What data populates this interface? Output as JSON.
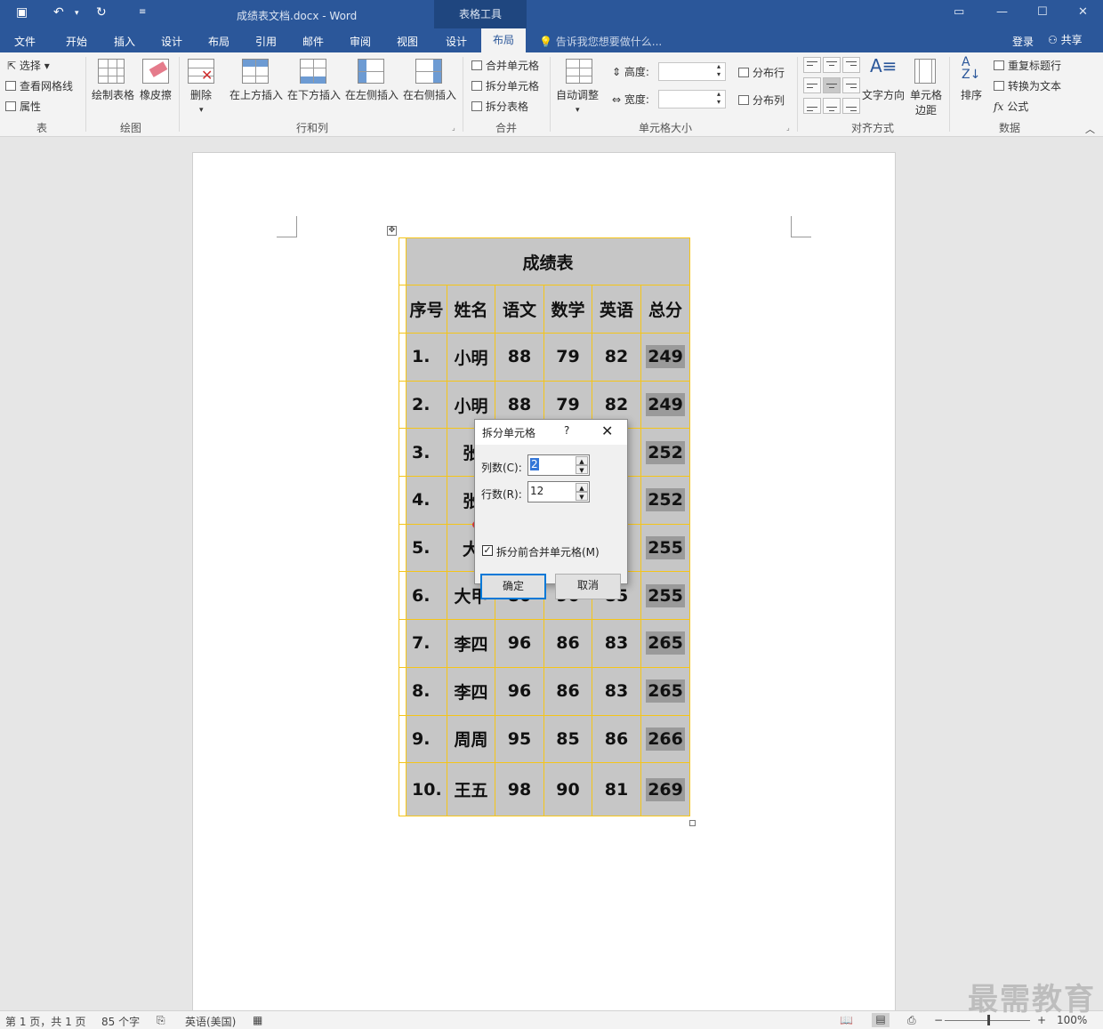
{
  "window": {
    "doc_title": "成绩表文档.docx - Word",
    "context_tools": "表格工具"
  },
  "tabs": {
    "file": "文件",
    "home": "开始",
    "insert": "插入",
    "design": "设计",
    "layout": "布局",
    "references": "引用",
    "mailings": "邮件",
    "review": "审阅",
    "view": "视图",
    "ctx_design": "设计",
    "ctx_layout": "布局",
    "tell_me": "告诉我您想要做什么...",
    "login": "登录",
    "share": "共享"
  },
  "ribbon": {
    "table": {
      "select": "选择",
      "gridlines": "查看网格线",
      "properties": "属性",
      "label": "表"
    },
    "draw": {
      "draw_table": "绘制表格",
      "eraser": "橡皮擦",
      "label": "绘图"
    },
    "rows_cols": {
      "delete": "删除",
      "insert_above": "在上方插入",
      "insert_below": "在下方插入",
      "insert_left": "在左侧插入",
      "insert_right": "在右侧插入",
      "label": "行和列"
    },
    "merge": {
      "merge_cells": "合并单元格",
      "split_cells": "拆分单元格",
      "split_table": "拆分表格",
      "label": "合并"
    },
    "cell_size": {
      "autofit": "自动调整",
      "height": "高度:",
      "width": "宽度:",
      "dist_rows": "分布行",
      "dist_cols": "分布列",
      "label": "单元格大小"
    },
    "alignment": {
      "text_direction": "文字方向",
      "cell_margins_1": "单元格",
      "cell_margins_2": "边距",
      "label": "对齐方式"
    },
    "data": {
      "sort": "排序",
      "repeat_header": "重复标题行",
      "convert_text": "转换为文本",
      "formula": "公式",
      "label": "数据"
    }
  },
  "table": {
    "title": "成绩表",
    "headers": [
      "序号",
      "姓名",
      "语文",
      "数学",
      "英语",
      "总分"
    ],
    "rows": [
      [
        "1.",
        "小明",
        "88",
        "79",
        "82",
        "249"
      ],
      [
        "2.",
        "小明",
        "88",
        "79",
        "82",
        "249"
      ],
      [
        "3.",
        "张",
        "",
        "",
        "",
        "252"
      ],
      [
        "4.",
        "张",
        "",
        "",
        "",
        "252"
      ],
      [
        "5.",
        "大",
        "",
        "",
        "",
        "255"
      ],
      [
        "6.",
        "大甲",
        "80",
        "90",
        "85",
        "255"
      ],
      [
        "7.",
        "李四",
        "96",
        "86",
        "83",
        "265"
      ],
      [
        "8.",
        "李四",
        "96",
        "86",
        "83",
        "265"
      ],
      [
        "9.",
        "周周",
        "95",
        "85",
        "86",
        "266"
      ],
      [
        "10.",
        "王五",
        "98",
        "90",
        "81",
        "269"
      ]
    ]
  },
  "dialog": {
    "title": "拆分单元格",
    "help": "?",
    "columns_label": "列数(C):",
    "columns_value": "2",
    "rows_label": "行数(R):",
    "rows_value": "12",
    "merge_before_split": "拆分前合并单元格(M)",
    "merge_checked": true,
    "ok": "确定",
    "cancel": "取消"
  },
  "status": {
    "page": "第 1 页，共 1 页",
    "words": "85 个字",
    "language": "英语(美国)",
    "zoom": "100%"
  },
  "watermark": "最需教育",
  "colors": {
    "accent": "#2b579a",
    "table_border": "#f5c518",
    "highlight_ellipse": "#e03a3a"
  }
}
